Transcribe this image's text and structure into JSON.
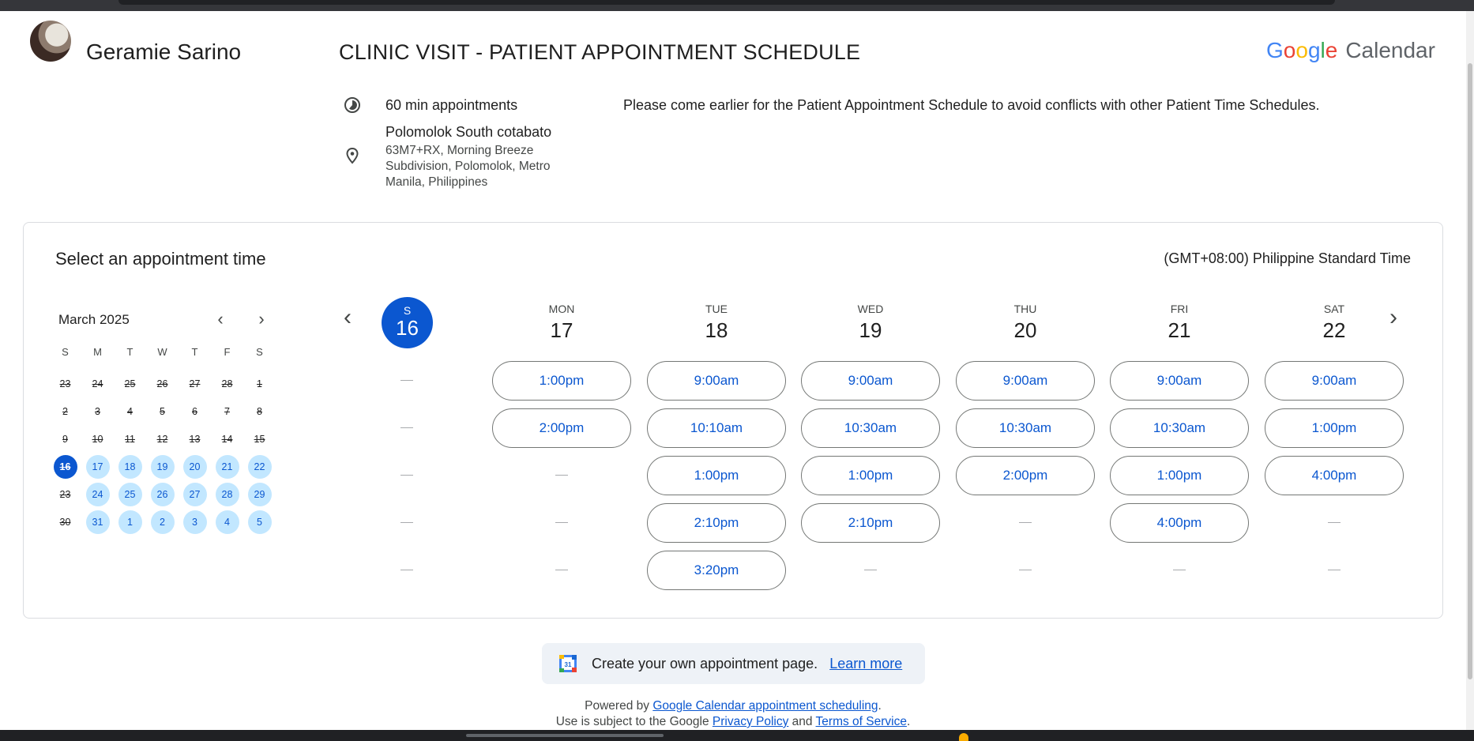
{
  "header": {
    "owner_name": "Geramie Sarino",
    "page_title": "CLINIC VISIT - PATIENT APPOINTMENT SCHEDULE",
    "brand_google": [
      "G",
      "o",
      "o",
      "g",
      "l",
      "e"
    ],
    "brand_google_colors": [
      "#4285F4",
      "#EA4335",
      "#FBBC05",
      "#4285F4",
      "#34A853",
      "#EA4335"
    ],
    "brand_product": "Calendar"
  },
  "details": {
    "duration": "60 min appointments",
    "location_title": "Polomolok South cotabato",
    "location_address": "63M7+RX, Morning Breeze Subdivision, Polomolok, Metro Manila, Philippines",
    "description": "Please come earlier for the Patient Appointment Schedule to avoid conflicts with other Patient Time Schedules."
  },
  "booking": {
    "heading": "Select an appointment time",
    "timezone": "(GMT+08:00) Philippine Standard Time"
  },
  "mini_calendar": {
    "month_label": "March 2025",
    "weekday_headers": [
      "S",
      "M",
      "T",
      "W",
      "T",
      "F",
      "S"
    ],
    "weeks": [
      [
        {
          "d": "23",
          "s": "past"
        },
        {
          "d": "24",
          "s": "past"
        },
        {
          "d": "25",
          "s": "past"
        },
        {
          "d": "26",
          "s": "past"
        },
        {
          "d": "27",
          "s": "past"
        },
        {
          "d": "28",
          "s": "past"
        },
        {
          "d": "1",
          "s": "past"
        }
      ],
      [
        {
          "d": "2",
          "s": "past"
        },
        {
          "d": "3",
          "s": "past"
        },
        {
          "d": "4",
          "s": "past"
        },
        {
          "d": "5",
          "s": "past"
        },
        {
          "d": "6",
          "s": "past"
        },
        {
          "d": "7",
          "s": "past"
        },
        {
          "d": "8",
          "s": "past"
        }
      ],
      [
        {
          "d": "9",
          "s": "past"
        },
        {
          "d": "10",
          "s": "past"
        },
        {
          "d": "11",
          "s": "past"
        },
        {
          "d": "12",
          "s": "past"
        },
        {
          "d": "13",
          "s": "past"
        },
        {
          "d": "14",
          "s": "past"
        },
        {
          "d": "15",
          "s": "past"
        }
      ],
      [
        {
          "d": "16",
          "s": "selected"
        },
        {
          "d": "17",
          "s": "avail"
        },
        {
          "d": "18",
          "s": "avail"
        },
        {
          "d": "19",
          "s": "avail"
        },
        {
          "d": "20",
          "s": "avail"
        },
        {
          "d": "21",
          "s": "avail"
        },
        {
          "d": "22",
          "s": "avail"
        }
      ],
      [
        {
          "d": "23",
          "s": "past"
        },
        {
          "d": "24",
          "s": "avail"
        },
        {
          "d": "25",
          "s": "avail"
        },
        {
          "d": "26",
          "s": "avail"
        },
        {
          "d": "27",
          "s": "avail"
        },
        {
          "d": "28",
          "s": "avail"
        },
        {
          "d": "29",
          "s": "avail"
        }
      ],
      [
        {
          "d": "30",
          "s": "past"
        },
        {
          "d": "31",
          "s": "avail"
        },
        {
          "d": "1",
          "s": "avail"
        },
        {
          "d": "2",
          "s": "avail"
        },
        {
          "d": "3",
          "s": "avail"
        },
        {
          "d": "4",
          "s": "avail"
        },
        {
          "d": "5",
          "s": "avail"
        }
      ]
    ]
  },
  "week": {
    "today": {
      "dow": "S",
      "num": "16"
    },
    "days": [
      {
        "dow": "MON",
        "num": "17",
        "slots": [
          "1:00pm",
          "2:00pm"
        ]
      },
      {
        "dow": "TUE",
        "num": "18",
        "slots": [
          "9:00am",
          "10:10am",
          "1:00pm",
          "2:10pm",
          "3:20pm"
        ]
      },
      {
        "dow": "WED",
        "num": "19",
        "slots": [
          "9:00am",
          "10:30am",
          "1:00pm",
          "2:10pm"
        ]
      },
      {
        "dow": "THU",
        "num": "20",
        "slots": [
          "9:00am",
          "10:30am",
          "2:00pm"
        ]
      },
      {
        "dow": "FRI",
        "num": "21",
        "slots": [
          "9:00am",
          "10:30am",
          "1:00pm",
          "4:00pm"
        ]
      },
      {
        "dow": "SAT",
        "num": "22",
        "slots": [
          "9:00am",
          "1:00pm",
          "4:00pm"
        ]
      }
    ],
    "rows": 5
  },
  "promo": {
    "icon_label": "31",
    "text": "Create your own appointment page.",
    "link": "Learn more"
  },
  "footer": {
    "powered_prefix": "Powered by ",
    "powered_link": "Google Calendar appointment scheduling",
    "powered_suffix": ".",
    "terms_prefix": "Use is subject to the Google ",
    "privacy_link": "Privacy Policy",
    "terms_and": " and ",
    "terms_link": "Terms of Service",
    "terms_suffix": "."
  }
}
